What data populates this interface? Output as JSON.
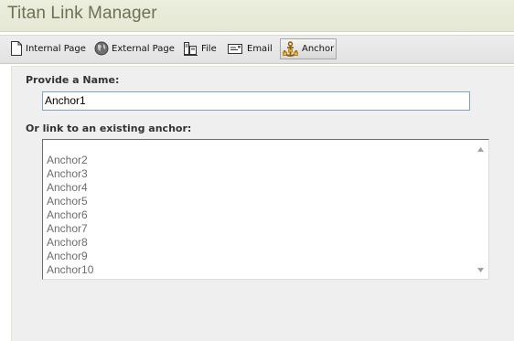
{
  "window": {
    "title": "Titan Link Manager"
  },
  "toolbar": {
    "items": [
      {
        "label": "Internal Page",
        "icon": "page-icon"
      },
      {
        "label": "External Page",
        "icon": "globe-icon"
      },
      {
        "label": "File",
        "icon": "file-icon"
      },
      {
        "label": "Email",
        "icon": "email-icon"
      },
      {
        "label": "Anchor",
        "icon": "anchor-icon",
        "active": true
      }
    ]
  },
  "form": {
    "name_label": "Provide a Name:",
    "name_value": "Anchor1",
    "existing_label": "Or link to an existing anchor:",
    "anchors": [
      "Anchor2",
      "Anchor3",
      "Anchor4",
      "Anchor5",
      "Anchor6",
      "Anchor7",
      "Anchor8",
      "Anchor9",
      "Anchor10"
    ]
  },
  "colors": {
    "title_text": "#6e7155",
    "titlebar_bg": "#e8ebd8",
    "panel_bg": "#efefef",
    "input_border": "#7fa3c4",
    "list_text": "#6d6d6d"
  }
}
